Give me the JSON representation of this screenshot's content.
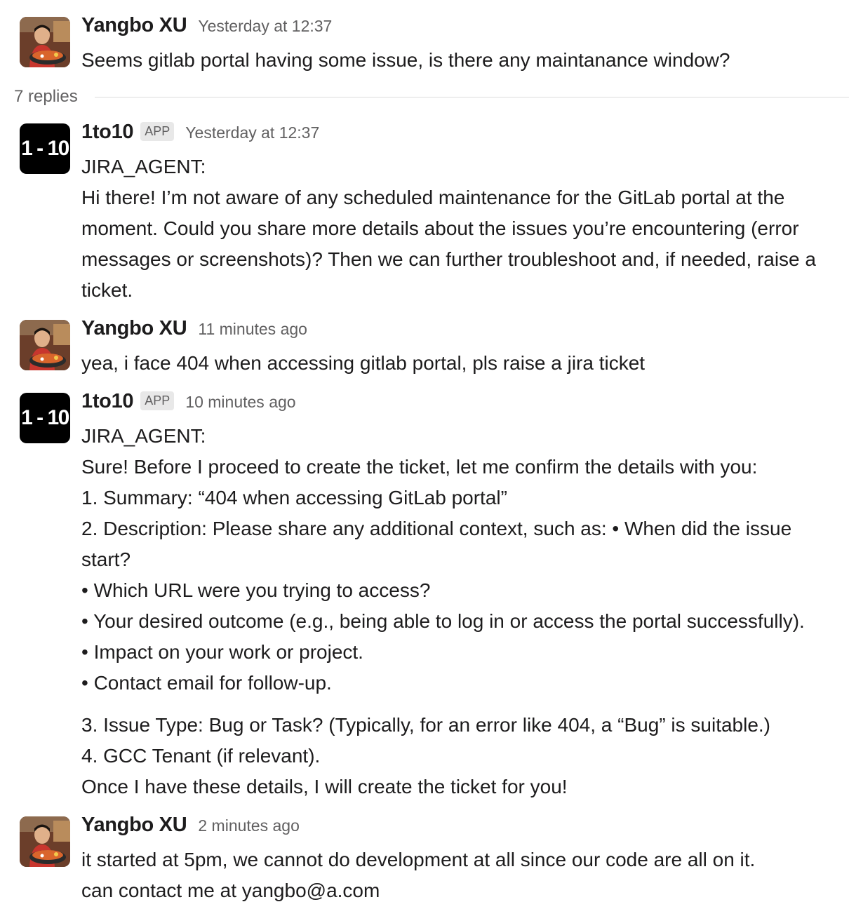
{
  "thread": {
    "replies_label": "7 replies",
    "messages": [
      {
        "author": "Yangbo XU",
        "avatar": "user-photo-avatar",
        "time": "Yesterday at 12:37",
        "lines": [
          "Seems gitlab portal having some issue, is there any maintanance window?"
        ]
      },
      {
        "author": "1to10",
        "badge": "APP",
        "avatar_text": "1 - 10",
        "time": "Yesterday at 12:37",
        "agent": "JIRA_AGENT",
        "agent_suffix": ":",
        "paragraph": "Hi there! I’m not aware of any scheduled maintenance for the GitLab portal at the moment. Could you share more details about the issues you’re encountering (error messages or screenshots)? Then we can further troubleshoot and, if needed, raise a ticket."
      },
      {
        "author": "Yangbo XU",
        "avatar": "user-photo-avatar",
        "time": "11 minutes ago",
        "lines": [
          "yea, i face 404 when accessing gitlab portal, pls raise a jira ticket"
        ]
      },
      {
        "author": "1to10",
        "badge": "APP",
        "avatar_text": "1 - 10",
        "time": "10 minutes ago",
        "agent": "JIRA_AGENT",
        "agent_suffix": ":",
        "lines": [
          "Sure! Before I proceed to create the ticket, let me confirm the details with you:",
          "1. Summary: “404 when accessing GitLab portal”",
          "2. Description: Please share any additional context, such as:  • When did the issue",
          "start?",
          "• Which URL were you trying to access?",
          "• Your desired outcome (e.g., being able to log in or access the portal successfully).",
          "• Impact on your work or project.",
          "• Contact email for follow-up."
        ],
        "lines_after_gap": [
          "3. Issue Type: Bug or Task? (Typically, for an error like 404, a “Bug” is suitable.)",
          "4. GCC Tenant (if relevant).",
          "Once I have these details, I will create the ticket for you!"
        ]
      },
      {
        "author": "Yangbo XU",
        "avatar": "user-photo-avatar",
        "time": "2 minutes ago",
        "lines": [
          "it started at 5pm, we cannot do development at all since our code are all on it.",
          "can contact me at yangbo@a.com"
        ]
      }
    ]
  }
}
